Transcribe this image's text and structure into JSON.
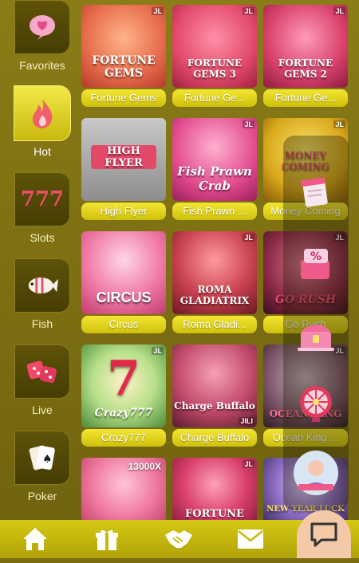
{
  "sidebar": {
    "categories": [
      {
        "label": "Favorites",
        "icon": "heart-chat-icon"
      },
      {
        "label": "Hot",
        "icon": "flame-icon"
      },
      {
        "label": "Slots",
        "icon": "sevens-icon"
      },
      {
        "label": "Fish",
        "icon": "fish-icon"
      },
      {
        "label": "Live",
        "icon": "dice-icon"
      },
      {
        "label": "Poker",
        "icon": "cards-icon"
      }
    ]
  },
  "games": [
    {
      "name": "Fortune Gems",
      "art": "FORTUNE GEMS",
      "badge": "JL"
    },
    {
      "name": "Fortune Ge...",
      "art": "FORTUNE GEMS 3",
      "badge": "JL"
    },
    {
      "name": "Fortune Ge...",
      "art": "FORTUNE GEMS 2",
      "badge": "JL"
    },
    {
      "name": "High Flyer",
      "art": "HIGH FLYER",
      "badge": ""
    },
    {
      "name": "Fish Prawn ...",
      "art": "Fish Prawn Crab",
      "badge": "JL"
    },
    {
      "name": "Money Coming",
      "art": "MONEY COMING",
      "badge": "JL"
    },
    {
      "name": "Circus",
      "art": "CIRCUS",
      "badge": ""
    },
    {
      "name": "Roma Gladi...",
      "art": "ROMA GLADIATRIX",
      "badge": "JL"
    },
    {
      "name": "Go Rush",
      "art": "GO RUSH",
      "badge": "JL"
    },
    {
      "name": "Crazy777",
      "art": "Crazy777",
      "badge": "JL"
    },
    {
      "name": "Charge Buffalo",
      "art": "Charge Buffalo",
      "badge": "JILI"
    },
    {
      "name": "Ocean King ...",
      "art": "OCEAN KING",
      "badge": "JL"
    },
    {
      "name": "",
      "art": "13000X",
      "badge": ""
    },
    {
      "name": "",
      "art": "FORTUNE",
      "badge": "JL"
    },
    {
      "name": "",
      "art": "NEW YEAR LUCK",
      "badge": ""
    }
  ],
  "float_panel": {
    "items": [
      {
        "icon": "notepad-icon"
      },
      {
        "icon": "percent-gift-icon"
      },
      {
        "icon": "treasure-chest-icon"
      },
      {
        "icon": "prize-wheel-icon"
      },
      {
        "icon": "avatar-promo-icon"
      }
    ]
  },
  "bottom_nav": [
    {
      "icon": "home-icon"
    },
    {
      "icon": "gift-icon"
    },
    {
      "icon": "handshake-icon"
    },
    {
      "icon": "mail-icon"
    }
  ],
  "chat_icon": "chat-bubble-icon"
}
